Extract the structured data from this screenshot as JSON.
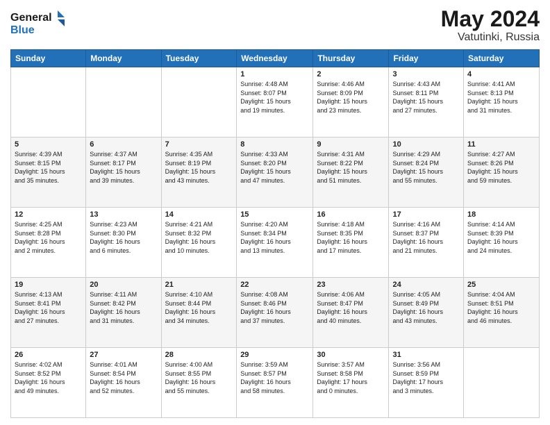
{
  "header": {
    "logo_line1": "General",
    "logo_line2": "Blue",
    "title": "May 2024",
    "subtitle": "Vatutinki, Russia"
  },
  "days_of_week": [
    "Sunday",
    "Monday",
    "Tuesday",
    "Wednesday",
    "Thursday",
    "Friday",
    "Saturday"
  ],
  "weeks": [
    [
      {
        "date": "",
        "info": ""
      },
      {
        "date": "",
        "info": ""
      },
      {
        "date": "",
        "info": ""
      },
      {
        "date": "1",
        "info": "Sunrise: 4:48 AM\nSunset: 8:07 PM\nDaylight: 15 hours\nand 19 minutes."
      },
      {
        "date": "2",
        "info": "Sunrise: 4:46 AM\nSunset: 8:09 PM\nDaylight: 15 hours\nand 23 minutes."
      },
      {
        "date": "3",
        "info": "Sunrise: 4:43 AM\nSunset: 8:11 PM\nDaylight: 15 hours\nand 27 minutes."
      },
      {
        "date": "4",
        "info": "Sunrise: 4:41 AM\nSunset: 8:13 PM\nDaylight: 15 hours\nand 31 minutes."
      }
    ],
    [
      {
        "date": "5",
        "info": "Sunrise: 4:39 AM\nSunset: 8:15 PM\nDaylight: 15 hours\nand 35 minutes."
      },
      {
        "date": "6",
        "info": "Sunrise: 4:37 AM\nSunset: 8:17 PM\nDaylight: 15 hours\nand 39 minutes."
      },
      {
        "date": "7",
        "info": "Sunrise: 4:35 AM\nSunset: 8:19 PM\nDaylight: 15 hours\nand 43 minutes."
      },
      {
        "date": "8",
        "info": "Sunrise: 4:33 AM\nSunset: 8:20 PM\nDaylight: 15 hours\nand 47 minutes."
      },
      {
        "date": "9",
        "info": "Sunrise: 4:31 AM\nSunset: 8:22 PM\nDaylight: 15 hours\nand 51 minutes."
      },
      {
        "date": "10",
        "info": "Sunrise: 4:29 AM\nSunset: 8:24 PM\nDaylight: 15 hours\nand 55 minutes."
      },
      {
        "date": "11",
        "info": "Sunrise: 4:27 AM\nSunset: 8:26 PM\nDaylight: 15 hours\nand 59 minutes."
      }
    ],
    [
      {
        "date": "12",
        "info": "Sunrise: 4:25 AM\nSunset: 8:28 PM\nDaylight: 16 hours\nand 2 minutes."
      },
      {
        "date": "13",
        "info": "Sunrise: 4:23 AM\nSunset: 8:30 PM\nDaylight: 16 hours\nand 6 minutes."
      },
      {
        "date": "14",
        "info": "Sunrise: 4:21 AM\nSunset: 8:32 PM\nDaylight: 16 hours\nand 10 minutes."
      },
      {
        "date": "15",
        "info": "Sunrise: 4:20 AM\nSunset: 8:34 PM\nDaylight: 16 hours\nand 13 minutes."
      },
      {
        "date": "16",
        "info": "Sunrise: 4:18 AM\nSunset: 8:35 PM\nDaylight: 16 hours\nand 17 minutes."
      },
      {
        "date": "17",
        "info": "Sunrise: 4:16 AM\nSunset: 8:37 PM\nDaylight: 16 hours\nand 21 minutes."
      },
      {
        "date": "18",
        "info": "Sunrise: 4:14 AM\nSunset: 8:39 PM\nDaylight: 16 hours\nand 24 minutes."
      }
    ],
    [
      {
        "date": "19",
        "info": "Sunrise: 4:13 AM\nSunset: 8:41 PM\nDaylight: 16 hours\nand 27 minutes."
      },
      {
        "date": "20",
        "info": "Sunrise: 4:11 AM\nSunset: 8:42 PM\nDaylight: 16 hours\nand 31 minutes."
      },
      {
        "date": "21",
        "info": "Sunrise: 4:10 AM\nSunset: 8:44 PM\nDaylight: 16 hours\nand 34 minutes."
      },
      {
        "date": "22",
        "info": "Sunrise: 4:08 AM\nSunset: 8:46 PM\nDaylight: 16 hours\nand 37 minutes."
      },
      {
        "date": "23",
        "info": "Sunrise: 4:06 AM\nSunset: 8:47 PM\nDaylight: 16 hours\nand 40 minutes."
      },
      {
        "date": "24",
        "info": "Sunrise: 4:05 AM\nSunset: 8:49 PM\nDaylight: 16 hours\nand 43 minutes."
      },
      {
        "date": "25",
        "info": "Sunrise: 4:04 AM\nSunset: 8:51 PM\nDaylight: 16 hours\nand 46 minutes."
      }
    ],
    [
      {
        "date": "26",
        "info": "Sunrise: 4:02 AM\nSunset: 8:52 PM\nDaylight: 16 hours\nand 49 minutes."
      },
      {
        "date": "27",
        "info": "Sunrise: 4:01 AM\nSunset: 8:54 PM\nDaylight: 16 hours\nand 52 minutes."
      },
      {
        "date": "28",
        "info": "Sunrise: 4:00 AM\nSunset: 8:55 PM\nDaylight: 16 hours\nand 55 minutes."
      },
      {
        "date": "29",
        "info": "Sunrise: 3:59 AM\nSunset: 8:57 PM\nDaylight: 16 hours\nand 58 minutes."
      },
      {
        "date": "30",
        "info": "Sunrise: 3:57 AM\nSunset: 8:58 PM\nDaylight: 17 hours\nand 0 minutes."
      },
      {
        "date": "31",
        "info": "Sunrise: 3:56 AM\nSunset: 8:59 PM\nDaylight: 17 hours\nand 3 minutes."
      },
      {
        "date": "",
        "info": ""
      }
    ]
  ],
  "colors": {
    "header_bg": "#2170b8",
    "accent": "#2170b8"
  }
}
